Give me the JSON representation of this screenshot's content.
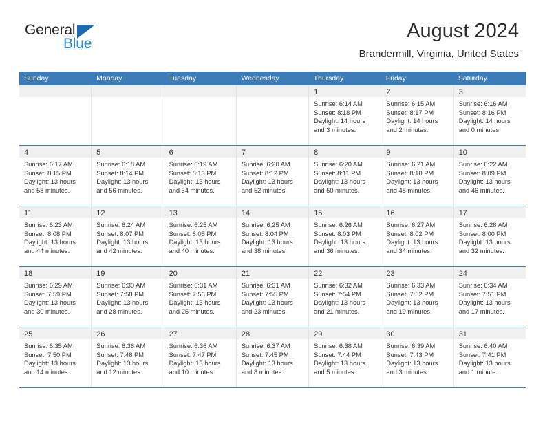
{
  "brand": {
    "name_top": "General",
    "name_bottom": "Blue",
    "triangle_icon": "brand-triangle-icon",
    "color_dark": "#231f20",
    "color_blue": "#2688d6"
  },
  "header": {
    "title": "August 2024",
    "subtitle": "Brandermill, Virginia, United States"
  },
  "theme": {
    "header_blue": "#3c7cb8",
    "day_band_gray": "#f0f0f0",
    "text": "#333333"
  },
  "calendar": {
    "day_names": [
      "Sunday",
      "Monday",
      "Tuesday",
      "Wednesday",
      "Thursday",
      "Friday",
      "Saturday"
    ],
    "weeks": [
      [
        {
          "day": "",
          "lines": []
        },
        {
          "day": "",
          "lines": []
        },
        {
          "day": "",
          "lines": []
        },
        {
          "day": "",
          "lines": []
        },
        {
          "day": "1",
          "lines": [
            "Sunrise: 6:14 AM",
            "Sunset: 8:18 PM",
            "Daylight: 14 hours",
            "and 3 minutes."
          ]
        },
        {
          "day": "2",
          "lines": [
            "Sunrise: 6:15 AM",
            "Sunset: 8:17 PM",
            "Daylight: 14 hours",
            "and 2 minutes."
          ]
        },
        {
          "day": "3",
          "lines": [
            "Sunrise: 6:16 AM",
            "Sunset: 8:16 PM",
            "Daylight: 14 hours",
            "and 0 minutes."
          ]
        }
      ],
      [
        {
          "day": "4",
          "lines": [
            "Sunrise: 6:17 AM",
            "Sunset: 8:15 PM",
            "Daylight: 13 hours",
            "and 58 minutes."
          ]
        },
        {
          "day": "5",
          "lines": [
            "Sunrise: 6:18 AM",
            "Sunset: 8:14 PM",
            "Daylight: 13 hours",
            "and 56 minutes."
          ]
        },
        {
          "day": "6",
          "lines": [
            "Sunrise: 6:19 AM",
            "Sunset: 8:13 PM",
            "Daylight: 13 hours",
            "and 54 minutes."
          ]
        },
        {
          "day": "7",
          "lines": [
            "Sunrise: 6:20 AM",
            "Sunset: 8:12 PM",
            "Daylight: 13 hours",
            "and 52 minutes."
          ]
        },
        {
          "day": "8",
          "lines": [
            "Sunrise: 6:20 AM",
            "Sunset: 8:11 PM",
            "Daylight: 13 hours",
            "and 50 minutes."
          ]
        },
        {
          "day": "9",
          "lines": [
            "Sunrise: 6:21 AM",
            "Sunset: 8:10 PM",
            "Daylight: 13 hours",
            "and 48 minutes."
          ]
        },
        {
          "day": "10",
          "lines": [
            "Sunrise: 6:22 AM",
            "Sunset: 8:09 PM",
            "Daylight: 13 hours",
            "and 46 minutes."
          ]
        }
      ],
      [
        {
          "day": "11",
          "lines": [
            "Sunrise: 6:23 AM",
            "Sunset: 8:08 PM",
            "Daylight: 13 hours",
            "and 44 minutes."
          ]
        },
        {
          "day": "12",
          "lines": [
            "Sunrise: 6:24 AM",
            "Sunset: 8:07 PM",
            "Daylight: 13 hours",
            "and 42 minutes."
          ]
        },
        {
          "day": "13",
          "lines": [
            "Sunrise: 6:25 AM",
            "Sunset: 8:05 PM",
            "Daylight: 13 hours",
            "and 40 minutes."
          ]
        },
        {
          "day": "14",
          "lines": [
            "Sunrise: 6:25 AM",
            "Sunset: 8:04 PM",
            "Daylight: 13 hours",
            "and 38 minutes."
          ]
        },
        {
          "day": "15",
          "lines": [
            "Sunrise: 6:26 AM",
            "Sunset: 8:03 PM",
            "Daylight: 13 hours",
            "and 36 minutes."
          ]
        },
        {
          "day": "16",
          "lines": [
            "Sunrise: 6:27 AM",
            "Sunset: 8:02 PM",
            "Daylight: 13 hours",
            "and 34 minutes."
          ]
        },
        {
          "day": "17",
          "lines": [
            "Sunrise: 6:28 AM",
            "Sunset: 8:00 PM",
            "Daylight: 13 hours",
            "and 32 minutes."
          ]
        }
      ],
      [
        {
          "day": "18",
          "lines": [
            "Sunrise: 6:29 AM",
            "Sunset: 7:59 PM",
            "Daylight: 13 hours",
            "and 30 minutes."
          ]
        },
        {
          "day": "19",
          "lines": [
            "Sunrise: 6:30 AM",
            "Sunset: 7:58 PM",
            "Daylight: 13 hours",
            "and 28 minutes."
          ]
        },
        {
          "day": "20",
          "lines": [
            "Sunrise: 6:31 AM",
            "Sunset: 7:56 PM",
            "Daylight: 13 hours",
            "and 25 minutes."
          ]
        },
        {
          "day": "21",
          "lines": [
            "Sunrise: 6:31 AM",
            "Sunset: 7:55 PM",
            "Daylight: 13 hours",
            "and 23 minutes."
          ]
        },
        {
          "day": "22",
          "lines": [
            "Sunrise: 6:32 AM",
            "Sunset: 7:54 PM",
            "Daylight: 13 hours",
            "and 21 minutes."
          ]
        },
        {
          "day": "23",
          "lines": [
            "Sunrise: 6:33 AM",
            "Sunset: 7:52 PM",
            "Daylight: 13 hours",
            "and 19 minutes."
          ]
        },
        {
          "day": "24",
          "lines": [
            "Sunrise: 6:34 AM",
            "Sunset: 7:51 PM",
            "Daylight: 13 hours",
            "and 17 minutes."
          ]
        }
      ],
      [
        {
          "day": "25",
          "lines": [
            "Sunrise: 6:35 AM",
            "Sunset: 7:50 PM",
            "Daylight: 13 hours",
            "and 14 minutes."
          ]
        },
        {
          "day": "26",
          "lines": [
            "Sunrise: 6:36 AM",
            "Sunset: 7:48 PM",
            "Daylight: 13 hours",
            "and 12 minutes."
          ]
        },
        {
          "day": "27",
          "lines": [
            "Sunrise: 6:36 AM",
            "Sunset: 7:47 PM",
            "Daylight: 13 hours",
            "and 10 minutes."
          ]
        },
        {
          "day": "28",
          "lines": [
            "Sunrise: 6:37 AM",
            "Sunset: 7:45 PM",
            "Daylight: 13 hours",
            "and 8 minutes."
          ]
        },
        {
          "day": "29",
          "lines": [
            "Sunrise: 6:38 AM",
            "Sunset: 7:44 PM",
            "Daylight: 13 hours",
            "and 5 minutes."
          ]
        },
        {
          "day": "30",
          "lines": [
            "Sunrise: 6:39 AM",
            "Sunset: 7:43 PM",
            "Daylight: 13 hours",
            "and 3 minutes."
          ]
        },
        {
          "day": "31",
          "lines": [
            "Sunrise: 6:40 AM",
            "Sunset: 7:41 PM",
            "Daylight: 13 hours",
            "and 1 minute."
          ]
        }
      ]
    ]
  }
}
